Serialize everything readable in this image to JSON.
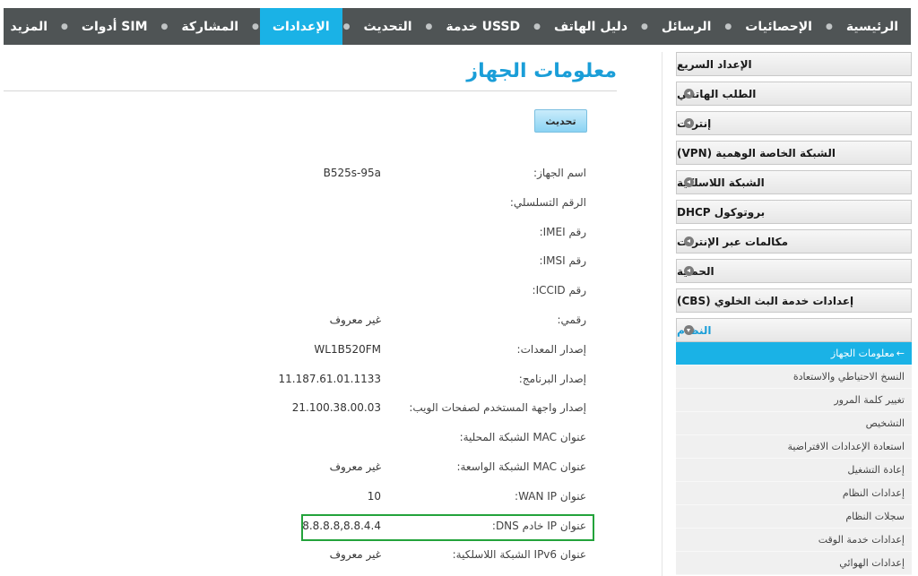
{
  "nav": [
    {
      "label": "الرئيسية",
      "active": false
    },
    {
      "label": "الإحصائيات",
      "active": false
    },
    {
      "label": "الرسائل",
      "active": false
    },
    {
      "label": "دليل الهاتف",
      "active": false
    },
    {
      "label": "خدمة USSD",
      "active": false
    },
    {
      "label": "التحديث",
      "active": false
    },
    {
      "label": "الإعدادات",
      "active": true
    },
    {
      "label": "المشاركة",
      "active": false
    },
    {
      "label": "أدوات SIM",
      "active": false
    },
    {
      "label": "المزيد",
      "active": false
    }
  ],
  "sidebar": {
    "items": [
      {
        "label": "الإعداد السريع",
        "arrow": false
      },
      {
        "label": "الطلب الهاتفي",
        "arrow": true
      },
      {
        "label": "إنترنت",
        "arrow": true
      },
      {
        "label": "الشبكة الخاصة الوهمية (VPN)",
        "arrow": false
      },
      {
        "label": "الشبكة اللاسلكية",
        "arrow": true
      },
      {
        "label": "بروتوكول DHCP",
        "arrow": false
      },
      {
        "label": "مكالمات عبر الإنترنت",
        "arrow": true
      },
      {
        "label": "الحماية",
        "arrow": true
      },
      {
        "label": "إعدادات خدمة البث الخلوي (CBS)",
        "arrow": false
      },
      {
        "label": "النظام",
        "arrow": true
      }
    ],
    "system_submenu": [
      {
        "label": "معلومات الجهاز",
        "active": true
      },
      {
        "label": "النسخ الاحتياطي والاستعادة",
        "active": false
      },
      {
        "label": "تغيير كلمة المرور",
        "active": false
      },
      {
        "label": "التشخيص",
        "active": false
      },
      {
        "label": "استعادة الإعدادات الافتراضية",
        "active": false
      },
      {
        "label": "إعادة التشغيل",
        "active": false
      },
      {
        "label": "إعدادات النظام",
        "active": false
      },
      {
        "label": "سجلات النظام",
        "active": false
      },
      {
        "label": "إعدادات خدمة الوقت",
        "active": false
      },
      {
        "label": "إعدادات الهوائي",
        "active": false
      }
    ]
  },
  "main": {
    "title": "معلومات الجهاز",
    "refresh_label": "تحديث",
    "rows": [
      {
        "label": "اسم الجهاز:",
        "value": "B525s-95a"
      },
      {
        "label": "الرقم التسلسلي:",
        "value": ""
      },
      {
        "label": "رقم IMEI:",
        "value": ""
      },
      {
        "label": "رقم IMSI:",
        "value": ""
      },
      {
        "label": "رقم ICCID:",
        "value": ""
      },
      {
        "label": "رقمي:",
        "value": "غير معروف"
      },
      {
        "label": "إصدار المعدات:",
        "value": "WL1B520FM"
      },
      {
        "label": "إصدار البرنامج:",
        "value": "11.187.61.01.1133"
      },
      {
        "label": "إصدار واجهة المستخدم لصفحات الويب:",
        "value": "21.100.38.00.03"
      },
      {
        "label": "عنوان MAC الشبكة المحلية:",
        "value": ""
      },
      {
        "label": "عنوان MAC الشبكة الواسعة:",
        "value": "غير معروف"
      },
      {
        "label": "عنوان WAN IP:",
        "value": "10"
      },
      {
        "label": "عنوان IP خادم DNS:",
        "value": "8.8.8.8,8.8.4.4"
      },
      {
        "label": "عنوان IPv6 الشبكة اللاسلكية:",
        "value": "غير معروف"
      }
    ]
  },
  "colors": {
    "accent": "#1ab2e6",
    "nav_bg": "#4f5455",
    "highlight": "#23a33b"
  }
}
